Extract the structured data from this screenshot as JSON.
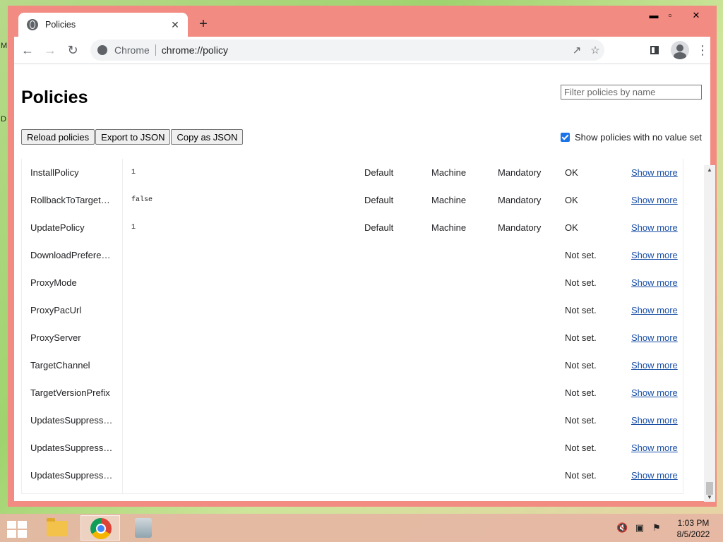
{
  "desktop": {
    "edge_letters": [
      "M",
      "D"
    ]
  },
  "window": {
    "tab_title": "Policies",
    "tab_close_glyph": "✕",
    "new_tab_glyph": "+",
    "controls": {
      "minimize": "▬",
      "maximize": "▫",
      "close": "✕"
    }
  },
  "toolbar": {
    "omnibox_origin": "Chrome",
    "omnibox_path": "chrome://policy",
    "icons": [
      "back-icon",
      "forward-icon",
      "reload-icon",
      "share-icon",
      "star-icon",
      "side-panel-icon",
      "profile-icon",
      "menu-icon"
    ]
  },
  "page": {
    "title": "Policies",
    "filter_placeholder": "Filter policies by name",
    "buttons": {
      "reload": "Reload policies",
      "export": "Export to JSON",
      "copy": "Copy as JSON"
    },
    "show_no_value_label": "Show policies with no value set",
    "show_no_value_checked": true
  },
  "policies": [
    {
      "name": "InstallPolicy",
      "value": "1",
      "source": "Default",
      "scope": "Machine",
      "level": "Mandatory",
      "status": "OK",
      "more": "Show more"
    },
    {
      "name": "RollbackToTarget…",
      "value": "false",
      "source": "Default",
      "scope": "Machine",
      "level": "Mandatory",
      "status": "OK",
      "more": "Show more"
    },
    {
      "name": "UpdatePolicy",
      "value": "1",
      "source": "Default",
      "scope": "Machine",
      "level": "Mandatory",
      "status": "OK",
      "more": "Show more"
    },
    {
      "name": "DownloadPreferen…",
      "value": "",
      "source": "",
      "scope": "",
      "level": "",
      "status": "Not set.",
      "more": "Show more"
    },
    {
      "name": "ProxyMode",
      "value": "",
      "source": "",
      "scope": "",
      "level": "",
      "status": "Not set.",
      "more": "Show more"
    },
    {
      "name": "ProxyPacUrl",
      "value": "",
      "source": "",
      "scope": "",
      "level": "",
      "status": "Not set.",
      "more": "Show more"
    },
    {
      "name": "ProxyServer",
      "value": "",
      "source": "",
      "scope": "",
      "level": "",
      "status": "Not set.",
      "more": "Show more"
    },
    {
      "name": "TargetChannel",
      "value": "",
      "source": "",
      "scope": "",
      "level": "",
      "status": "Not set.",
      "more": "Show more"
    },
    {
      "name": "TargetVersionPrefix",
      "value": "",
      "source": "",
      "scope": "",
      "level": "",
      "status": "Not set.",
      "more": "Show more"
    },
    {
      "name": "UpdatesSuppress…",
      "value": "",
      "source": "",
      "scope": "",
      "level": "",
      "status": "Not set.",
      "more": "Show more"
    },
    {
      "name": "UpdatesSuppress…",
      "value": "",
      "source": "",
      "scope": "",
      "level": "",
      "status": "Not set.",
      "more": "Show more"
    },
    {
      "name": "UpdatesSuppress…",
      "value": "",
      "source": "",
      "scope": "",
      "level": "",
      "status": "Not set.",
      "more": "Show more"
    }
  ],
  "taskbar": {
    "time": "1:03 PM",
    "date": "8/5/2022",
    "apps": [
      "file-explorer-icon",
      "chrome-icon",
      "recycle-bin-icon"
    ],
    "tray": [
      "volume-muted-icon",
      "network-icon",
      "action-center-flag-icon"
    ]
  },
  "colors": {
    "window_frame": "#f28b82",
    "checkbox": "#1a73e8",
    "link": "#1a4fa6"
  }
}
